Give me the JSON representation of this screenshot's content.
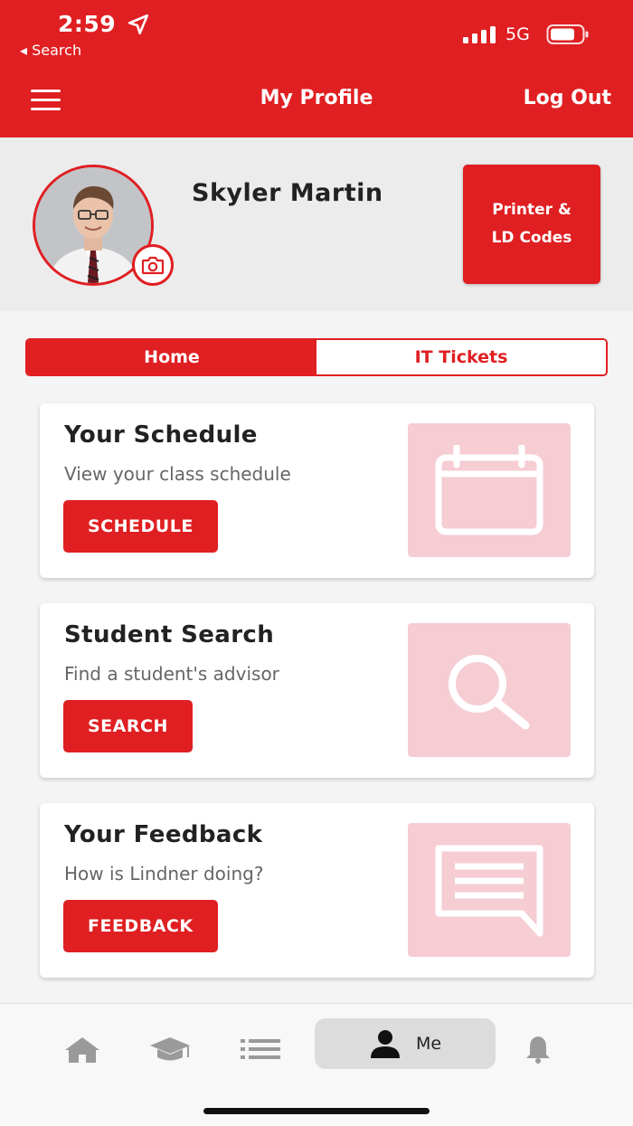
{
  "status_bar": {
    "time": "2:59",
    "back_label": "◂ Search",
    "network": "5G"
  },
  "nav_bar": {
    "title": "My Profile",
    "logout_label": "Log Out"
  },
  "profile": {
    "name": "Skyler Martin",
    "printer_button_line1": "Printer &",
    "printer_button_line2": "LD Codes"
  },
  "tabs": [
    {
      "label": "Home",
      "active": true
    },
    {
      "label": "IT Tickets",
      "active": false
    }
  ],
  "cards": [
    {
      "title": "Your Schedule",
      "subtitle": "View your class schedule",
      "button": "SCHEDULE",
      "icon": "calendar-icon"
    },
    {
      "title": "Student Search",
      "subtitle": "Find a student's advisor",
      "button": "SEARCH",
      "icon": "magnifier-icon"
    },
    {
      "title": "Your Feedback",
      "subtitle": "How is Lindner doing?",
      "button": "FEEDBACK",
      "icon": "chat-bubble-icon"
    }
  ],
  "bottom_nav": {
    "items": [
      "home-icon",
      "graduation-cap-icon",
      "list-icon",
      "person-icon",
      "bell-icon"
    ],
    "me_label": "Me"
  },
  "colors": {
    "accent": "#e01f22",
    "tile": "#f5cdd3"
  }
}
